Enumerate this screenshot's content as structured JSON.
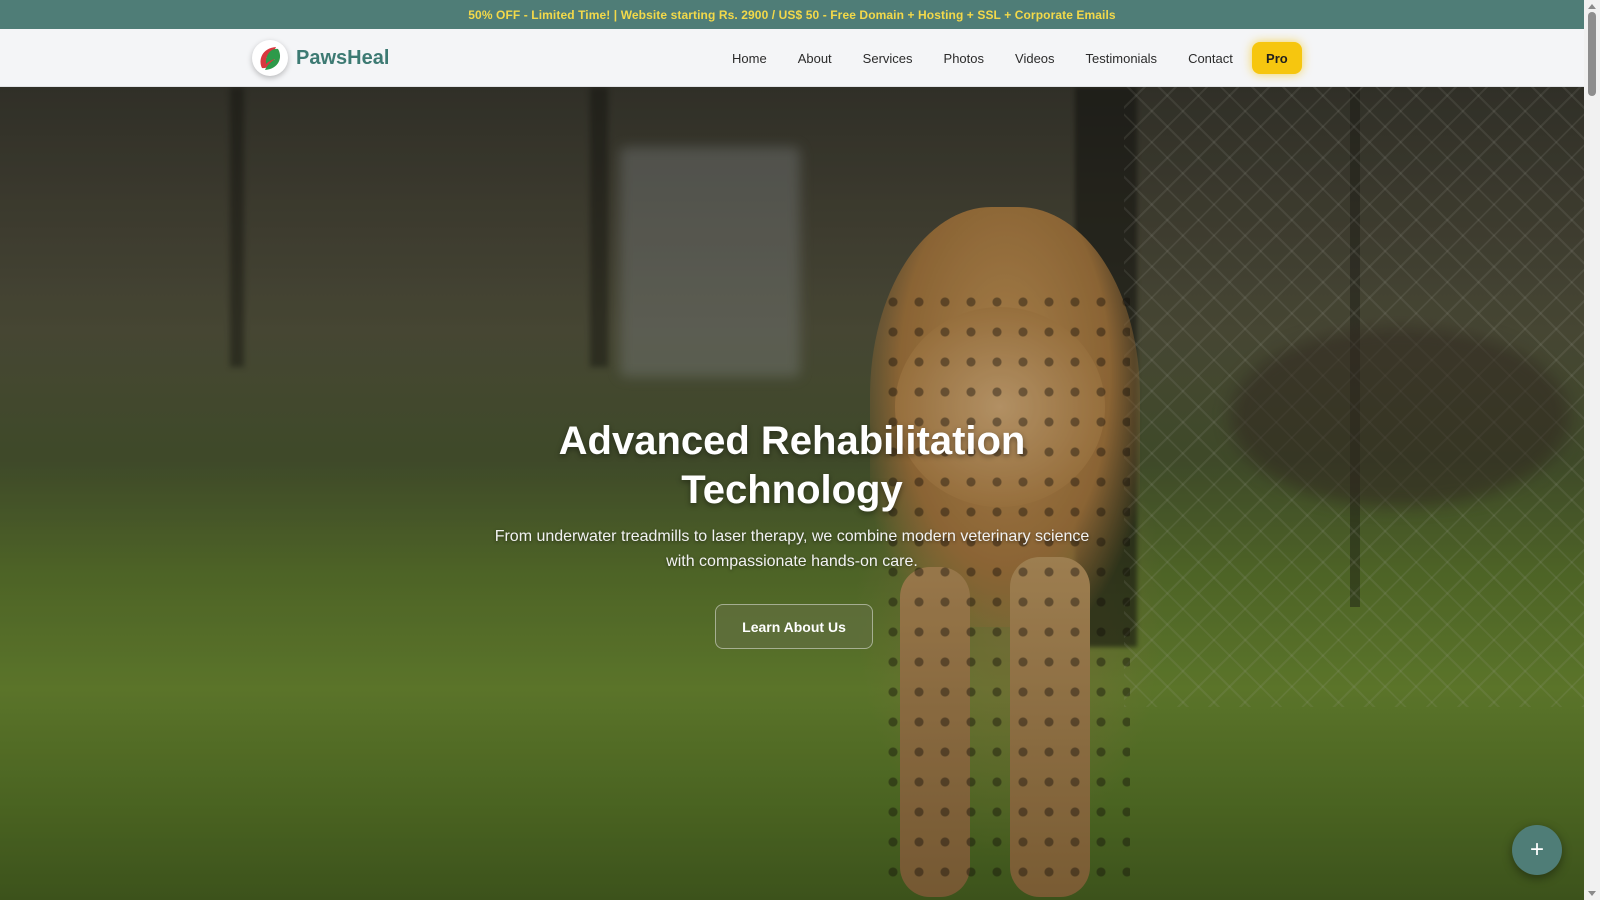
{
  "promo": {
    "text": "50% OFF - Limited Time! | Website starting Rs. 2900 / US$ 50 - Free Domain + Hosting + SSL + Corporate Emails"
  },
  "brand": {
    "name": "PawsHeal",
    "logo_icon": "leaf-logo-icon",
    "color": "#3d7a73"
  },
  "nav": {
    "items": [
      "Home",
      "About",
      "Services",
      "Photos",
      "Videos",
      "Testimonials",
      "Contact"
    ],
    "pro_label": "Pro",
    "pro_color": "#f6c60f"
  },
  "hero": {
    "title": "Advanced Rehabilitation Technology",
    "subtitle": "From underwater treadmills to laser therapy, we combine modern veterinary science with compassionate hands-on care.",
    "button_label": "Learn About Us",
    "background_image": "cheetah-in-enclosure-photo"
  },
  "fab": {
    "label": "+",
    "icon": "plus-icon",
    "color": "#4f7d77"
  }
}
